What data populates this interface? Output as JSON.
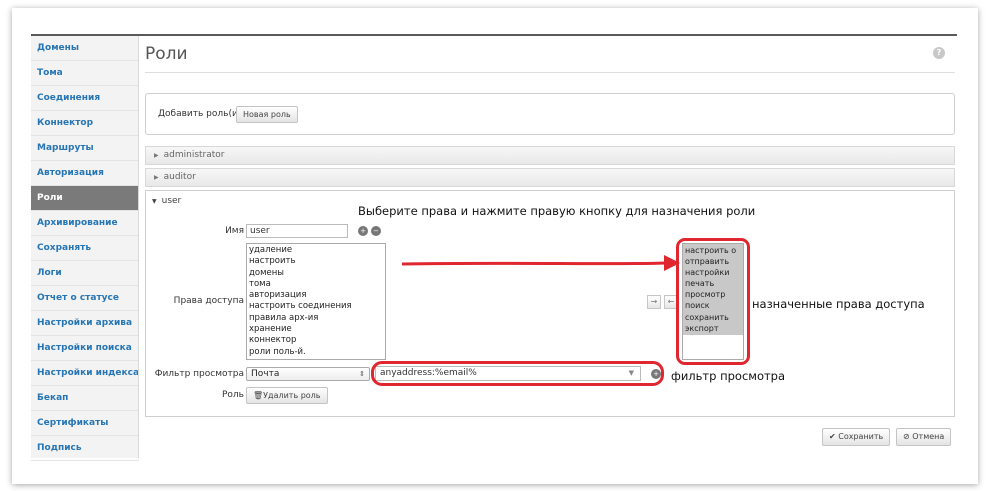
{
  "sidebar": {
    "items": [
      {
        "label": "Домены",
        "active": false
      },
      {
        "label": "Тома",
        "active": false
      },
      {
        "label": "Соединения",
        "active": false
      },
      {
        "label": "Коннектор",
        "active": false
      },
      {
        "label": "Маршруты",
        "active": false
      },
      {
        "label": "Авторизация",
        "active": false
      },
      {
        "label": "Роли",
        "active": true
      },
      {
        "label": "Архивирование",
        "active": false
      },
      {
        "label": "Сохранять",
        "active": false
      },
      {
        "label": "Логи",
        "active": false
      },
      {
        "label": "Отчет о статусе",
        "active": false
      },
      {
        "label": "Настройки архива",
        "active": false
      },
      {
        "label": "Настройки поиска",
        "active": false
      },
      {
        "label": "Настройки индекса",
        "active": false
      },
      {
        "label": "Бекап",
        "active": false
      },
      {
        "label": "Сертификаты",
        "active": false
      },
      {
        "label": "Подпись",
        "active": false
      }
    ]
  },
  "header": {
    "title": "Роли",
    "help_icon": "?"
  },
  "add_role": {
    "label": "Добавить роль(и)",
    "button": "Новая роль"
  },
  "roles": [
    {
      "name": "administrator",
      "expanded": false
    },
    {
      "name": "auditor",
      "expanded": false
    },
    {
      "name": "user",
      "expanded": true
    }
  ],
  "editor": {
    "name_label": "Имя",
    "name_value": "user",
    "rights_label": "Права доступа",
    "available_rights": [
      "удаление",
      "настроить",
      "домены",
      "тома",
      "авторизация",
      "настроить соединения",
      "правила арх-ия",
      "хранение",
      "коннектор",
      "роли поль-й."
    ],
    "assigned_rights": [
      "настроить о",
      "отправить",
      "настройки",
      "печать",
      "просмотр",
      "поиск",
      "сохранить",
      "экспорт"
    ],
    "filter_label": "Фильтр просмотра",
    "filter_type": "Почта",
    "filter_value": "anyaddress:%email%",
    "role_label": "Роль",
    "delete_button": "Удалить роль",
    "move_right_icon": "→",
    "move_left_icon": "←"
  },
  "annotations": {
    "instruction": "Выберите права и нажмите правую кнопку для назначения роли",
    "assigned": "назначенные права доступа",
    "filter": "фильтр просмотра"
  },
  "footer": {
    "save": "Сохранить",
    "cancel": "Отмена"
  },
  "colors": {
    "accent": "#2676b6",
    "annotation": "#e0272f",
    "active_nav": "#7a7a7a"
  }
}
